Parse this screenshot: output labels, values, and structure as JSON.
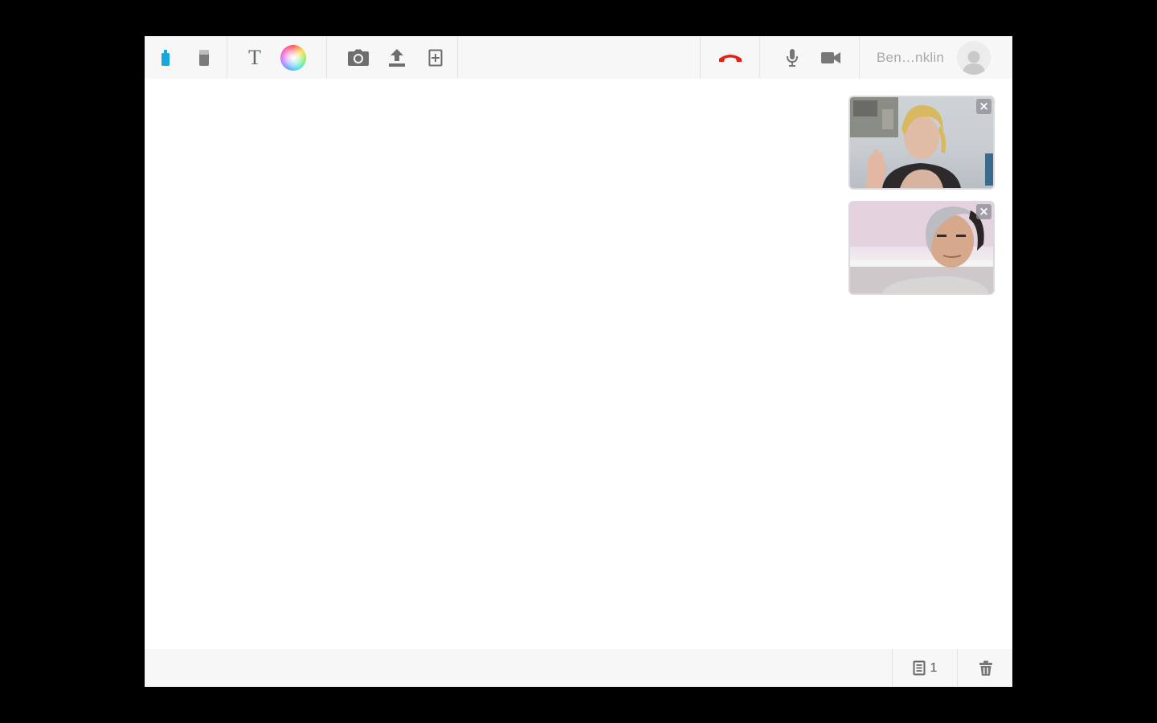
{
  "toolbar": {
    "tools": {
      "pen": "pen-icon",
      "eraser": "eraser-icon",
      "text": "T",
      "color": "color-wheel-icon"
    },
    "media": [
      "camera-icon",
      "upload-icon",
      "add-page-icon"
    ],
    "call": {
      "hangup": "hang-up-icon",
      "hangup_color": "#e0221b"
    },
    "av": [
      "microphone-icon",
      "video-camera-icon"
    ],
    "user": {
      "name": "Ben…nklin",
      "avatar": "avatar-icon"
    },
    "accent_color": "#17a9dc"
  },
  "videos": [
    {
      "close_label": "×"
    },
    {
      "close_label": "×"
    }
  ],
  "bottombar": {
    "page_count": "1",
    "page_icon": "pages-icon",
    "trash_icon": "trash-icon"
  }
}
